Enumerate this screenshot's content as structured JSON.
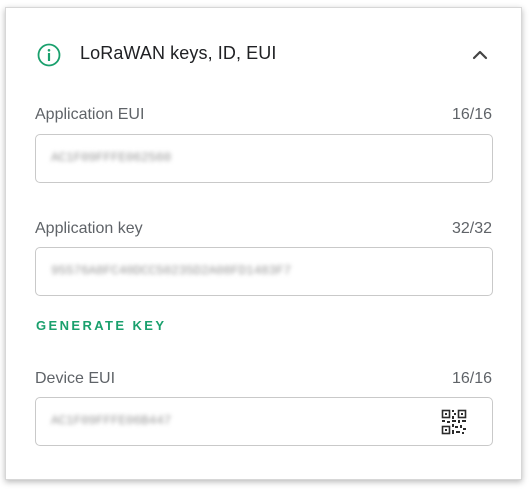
{
  "section": {
    "title": "LoRaWAN keys, ID, EUI",
    "icon": "info-icon",
    "collapse_icon": "chevron-up-icon"
  },
  "fields": {
    "app_eui": {
      "label": "Application EUI",
      "count": "16/16",
      "value": "AC1F09FFFE062560"
    },
    "app_key": {
      "label": "Application key",
      "count": "32/32",
      "value": "95576A8FC40DCC50235D2A08FD1483F7"
    },
    "dev_eui": {
      "label": "Device EUI",
      "count": "16/16",
      "value": "AC1F09FFFE06B447",
      "icon": "qr-code-icon"
    }
  },
  "actions": {
    "generate_key": "GENERATE KEY"
  },
  "colors": {
    "accent": "#1aa06d",
    "text": "#202124",
    "secondary": "#5f6368",
    "border": "#c9c9c9"
  }
}
